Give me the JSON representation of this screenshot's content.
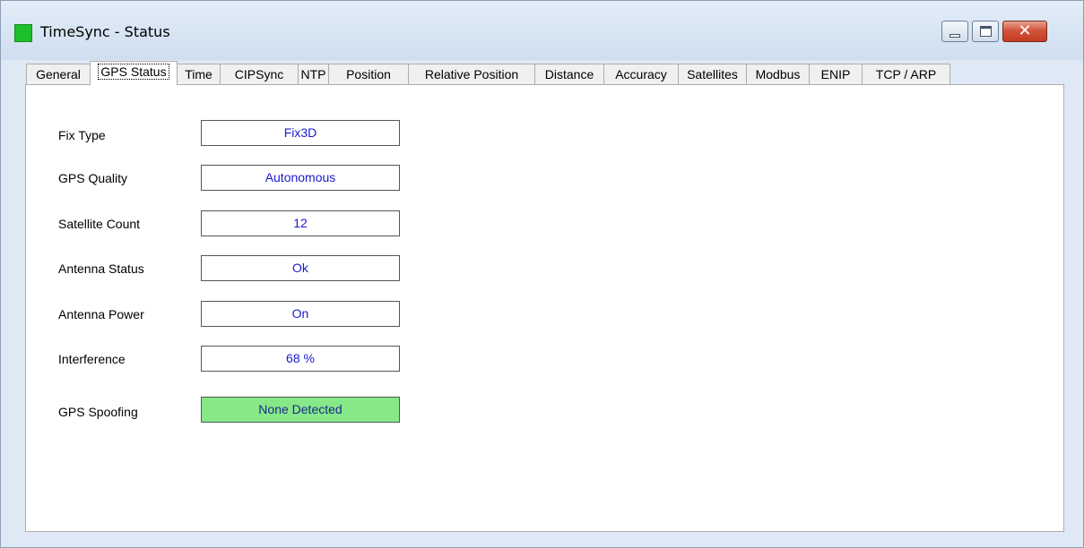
{
  "window": {
    "title": "TimeSync - Status"
  },
  "tabs": [
    {
      "label": "General"
    },
    {
      "label": "GPS Status",
      "active": true
    },
    {
      "label": "Time"
    },
    {
      "label": "CIPSync"
    },
    {
      "label": "NTP"
    },
    {
      "label": "Position"
    },
    {
      "label": "Relative Position"
    },
    {
      "label": "Distance"
    },
    {
      "label": "Accuracy"
    },
    {
      "label": "Satellites"
    },
    {
      "label": "Modbus"
    },
    {
      "label": "ENIP"
    },
    {
      "label": "TCP / ARP"
    }
  ],
  "gps_status": {
    "fix_type": {
      "label": "Fix Type",
      "value": "Fix3D"
    },
    "gps_quality": {
      "label": "GPS Quality",
      "value": "Autonomous"
    },
    "satellite_count": {
      "label": "Satellite Count",
      "value": "12"
    },
    "antenna_status": {
      "label": "Antenna Status",
      "value": "Ok"
    },
    "antenna_power": {
      "label": "Antenna Power",
      "value": "On"
    },
    "interference": {
      "label": "Interference",
      "value": "68 %"
    },
    "gps_spoofing": {
      "label": "GPS Spoofing",
      "value": "None Detected",
      "status_color": "#86e888"
    }
  },
  "icons": {
    "app": "app-status-icon",
    "minimize": "minimize-icon",
    "maximize": "maximize-icon",
    "close": "close-icon"
  },
  "colors": {
    "value_text": "#1a1acd",
    "ok_fill": "#86e888",
    "app_icon": "#1dbf2a",
    "close_button": "#c33b21"
  }
}
